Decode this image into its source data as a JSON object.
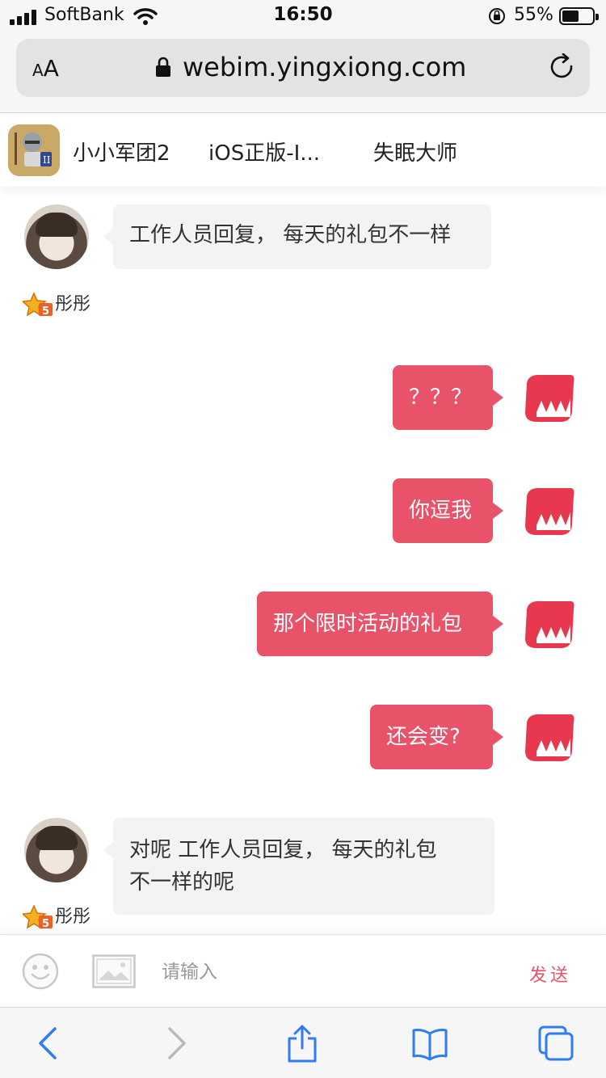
{
  "status_bar": {
    "carrier": "SoftBank",
    "time": "16:50",
    "battery_percent": "55%",
    "battery_level": 0.55
  },
  "browser": {
    "text_size_label_small": "A",
    "text_size_label_large": "A",
    "url": "webim.yingxiong.com"
  },
  "tabs": [
    {
      "label": "小小军团2"
    },
    {
      "label": "iOS正版-I..."
    },
    {
      "label": "失眠大师"
    }
  ],
  "messages": [
    {
      "side": "in",
      "text": "工作人员回复， 每天的礼包不一样",
      "user": "彤彤"
    },
    {
      "side": "out",
      "text": "？？？"
    },
    {
      "side": "out",
      "text": "你逗我"
    },
    {
      "side": "out",
      "text": "那个限时活动的礼包"
    },
    {
      "side": "out",
      "text": "还会变?"
    },
    {
      "side": "in",
      "text_line1": "对呢  工作人员回复， 每天的礼包",
      "text_line2": "不一样的呢",
      "user": "彤彤"
    }
  ],
  "input": {
    "placeholder": "请输入",
    "value": "",
    "send_label": "发送"
  },
  "colors": {
    "accent": "#e9536a",
    "incoming_bubble": "#f3f3f3",
    "link_blue": "#2f7cf6"
  },
  "icons": {
    "emoji": "smiley-icon",
    "image": "image-icon",
    "back": "chevron-left-icon",
    "forward": "chevron-right-icon",
    "share": "share-icon",
    "bookmarks": "book-icon",
    "tabs": "tabs-icon"
  }
}
